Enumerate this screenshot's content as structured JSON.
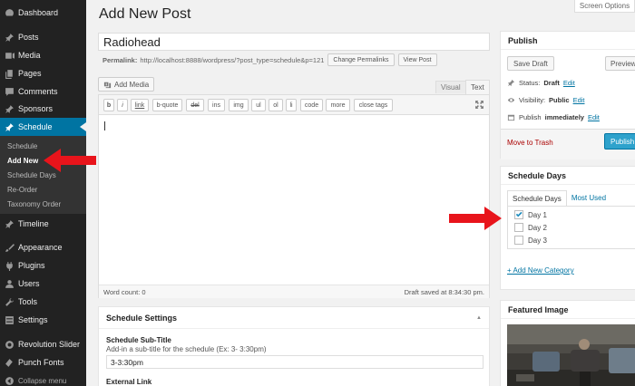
{
  "sidebar": {
    "items": [
      {
        "label": "Dashboard",
        "icon": "dashboard-icon"
      },
      {
        "label": "Posts",
        "icon": "pin-icon"
      },
      {
        "label": "Media",
        "icon": "media-icon"
      },
      {
        "label": "Pages",
        "icon": "pages-icon"
      },
      {
        "label": "Comments",
        "icon": "comments-icon"
      },
      {
        "label": "Sponsors",
        "icon": "pin-icon"
      },
      {
        "label": "Schedule",
        "icon": "pin-icon",
        "active": true
      },
      {
        "label": "Timeline",
        "icon": "pin-icon"
      },
      {
        "label": "Appearance",
        "icon": "brush-icon"
      },
      {
        "label": "Plugins",
        "icon": "plugin-icon"
      },
      {
        "label": "Users",
        "icon": "users-icon"
      },
      {
        "label": "Tools",
        "icon": "wrench-icon"
      },
      {
        "label": "Settings",
        "icon": "settings-icon"
      },
      {
        "label": "Revolution Slider",
        "icon": "slider-icon"
      },
      {
        "label": "Punch Fonts",
        "icon": "fonts-icon"
      },
      {
        "label": "Collapse menu",
        "icon": "collapse-icon"
      }
    ],
    "submenu": [
      "Schedule",
      "Add New",
      "Schedule Days",
      "Re-Order",
      "Taxonomy Order"
    ]
  },
  "header": {
    "screen_options": "Screen Options",
    "page_title": "Add New Post"
  },
  "post": {
    "title": "Radiohead",
    "permalink_label": "Permalink:",
    "permalink_url": "http://localhost:8888/wordpress/?post_type=schedule&p=121",
    "change_permalinks": "Change Permalinks",
    "view_post": "View Post"
  },
  "editor": {
    "add_media": "Add Media",
    "tab_visual": "Visual",
    "tab_text": "Text",
    "quicktags": [
      "b",
      "i",
      "link",
      "b-quote",
      "del",
      "ins",
      "img",
      "ul",
      "ol",
      "li",
      "code",
      "more",
      "close tags"
    ],
    "word_count": "Word count: 0",
    "draft_saved": "Draft saved at 8:34:30 pm."
  },
  "schedule_settings": {
    "title": "Schedule Settings",
    "toggle": "▲",
    "subtitle_label": "Schedule Sub-Title",
    "subtitle_desc": "Add-in a sub-title for the schedule (Ex: 3- 3:30pm)",
    "subtitle_value": "3-3:30pm",
    "external_link_label": "External Link"
  },
  "publish": {
    "title": "Publish",
    "save_draft": "Save Draft",
    "preview": "Preview",
    "status_label": "Status:",
    "status_value": "Draft",
    "visibility_label": "Visibility:",
    "visibility_value": "Public",
    "publish_label": "Publish",
    "publish_value": "immediately",
    "edit": "Edit",
    "trash": "Move to Trash",
    "publish_button": "Publish"
  },
  "schedule_days": {
    "title": "Schedule Days",
    "tab_all": "Schedule Days",
    "tab_most_used": "Most Used",
    "days": [
      {
        "label": "Day 1",
        "checked": true
      },
      {
        "label": "Day 2",
        "checked": false
      },
      {
        "label": "Day 3",
        "checked": false
      }
    ],
    "add_new": "+ Add New Category"
  },
  "featured_image": {
    "title": "Featured Image"
  },
  "colors": {
    "sidebar_bg": "#222222",
    "active_blue": "#0074a2",
    "publish_blue": "#2ea2cc",
    "arrow_red": "#e8141b",
    "trash_red": "#aa0000"
  }
}
